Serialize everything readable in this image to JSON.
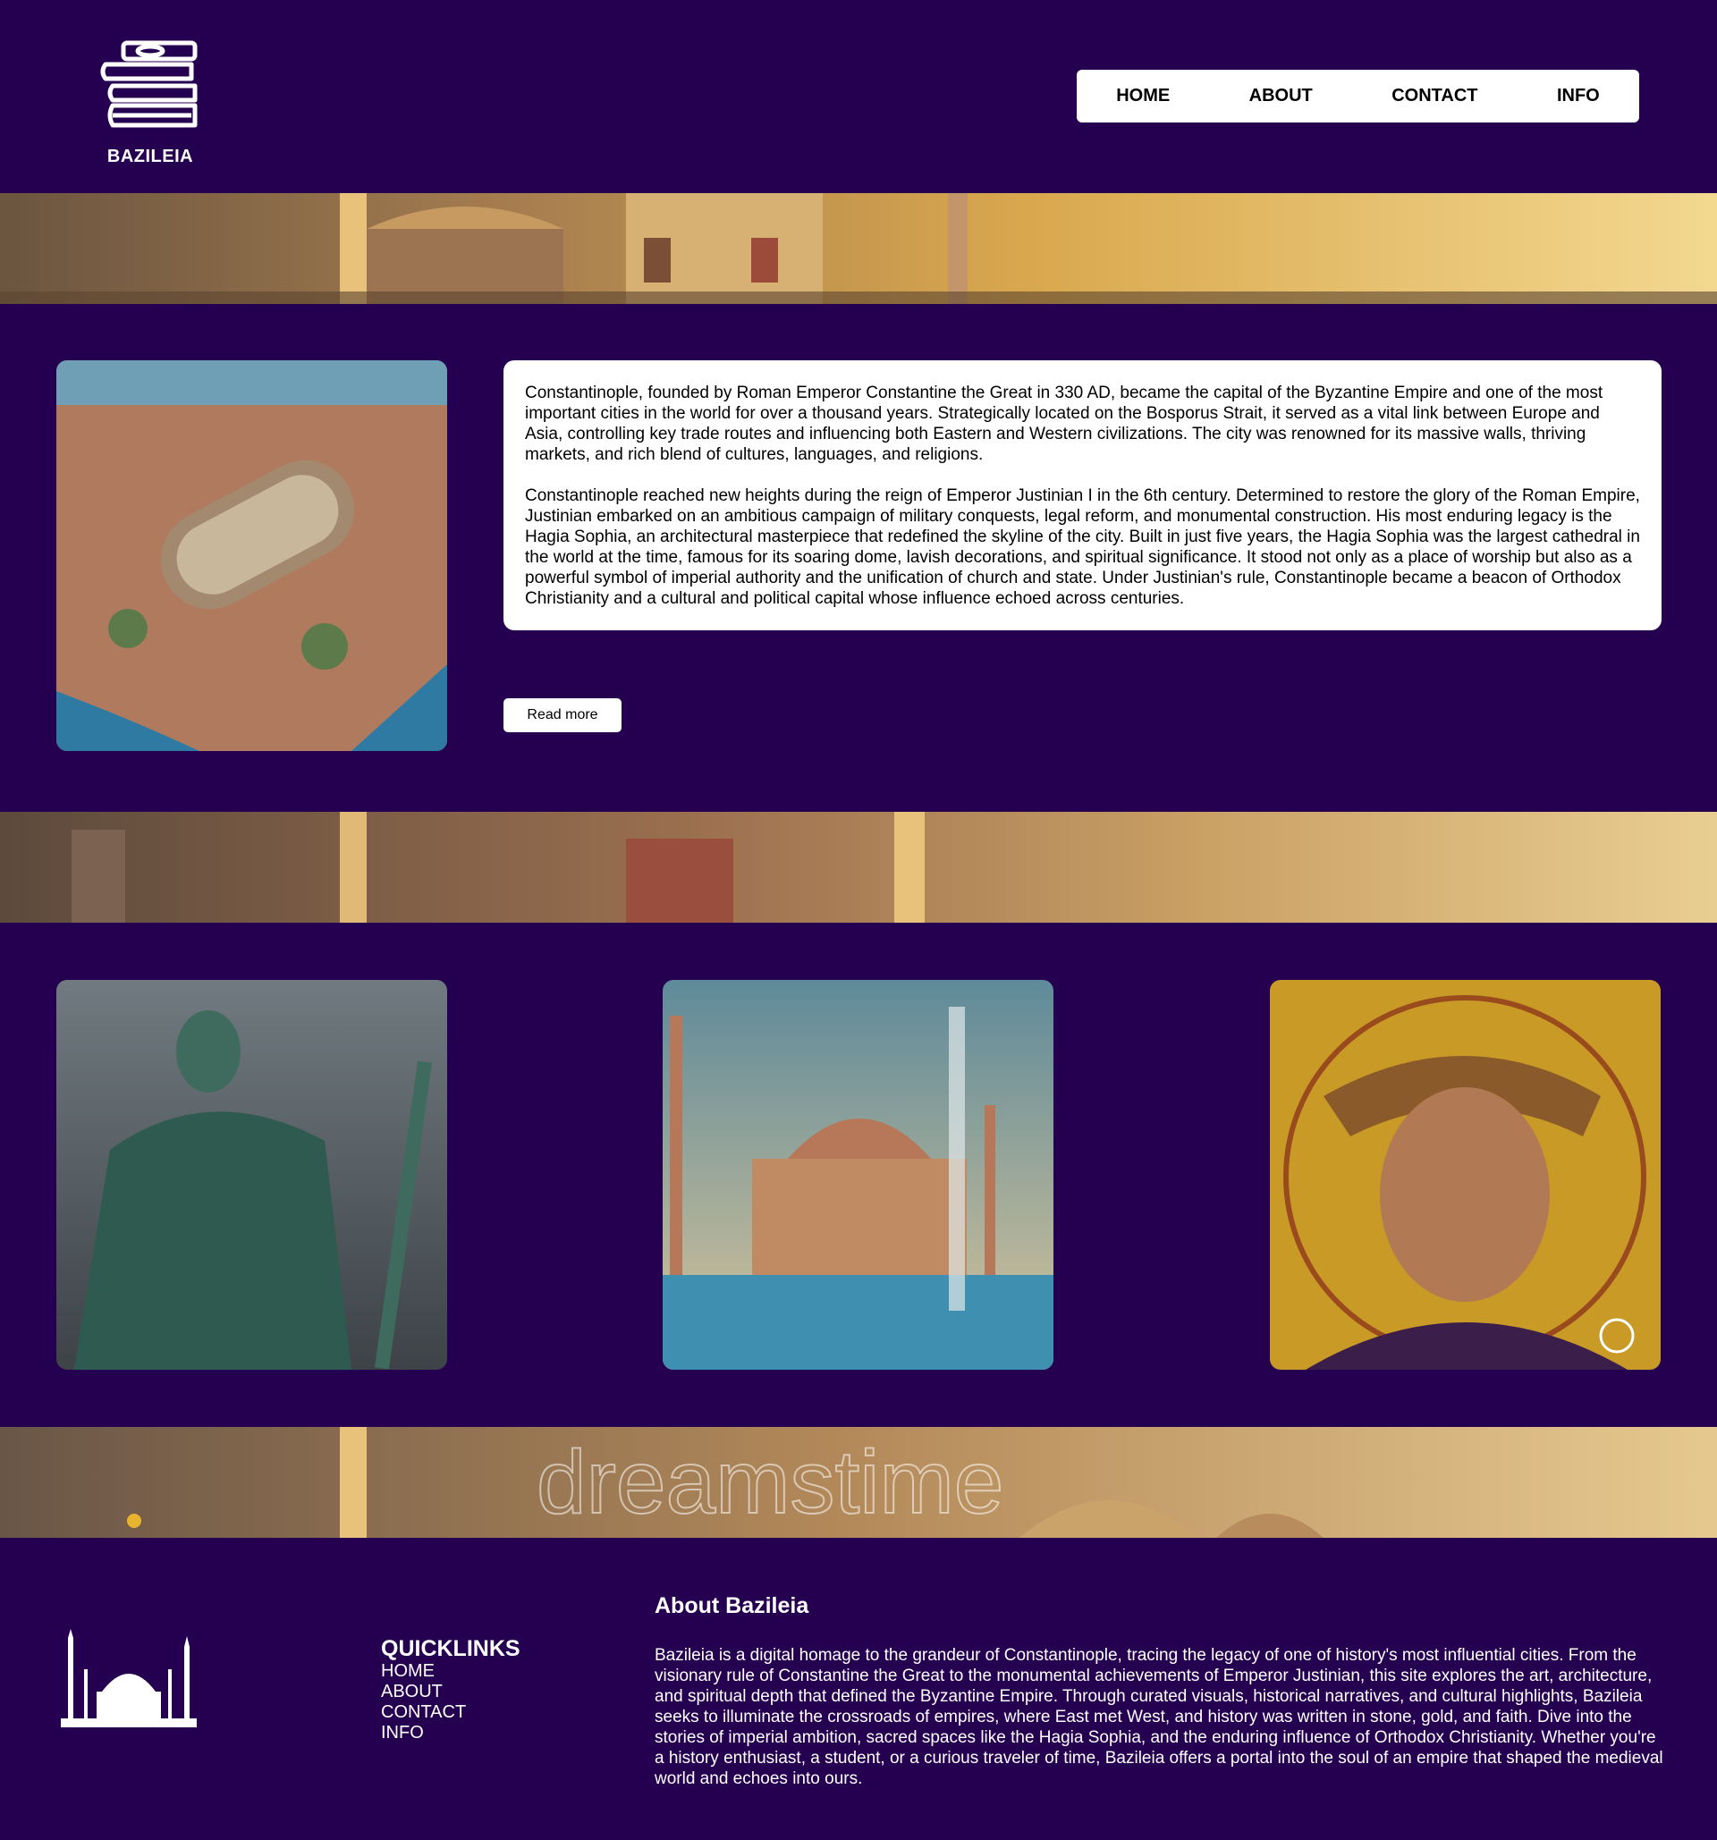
{
  "header": {
    "brand": "BAZILEIA",
    "nav": [
      "HOME",
      "ABOUT",
      "CONTACT",
      "INFO"
    ]
  },
  "intro": {
    "paragraphs": [
      "Constantinople, founded by Roman Emperor Constantine the Great in 330 AD, became the capital of the Byzantine Empire and one of the most important cities in the world for over a thousand years. Strategically located on the Bosporus Strait, it served as a vital link between Europe and Asia, controlling key trade routes and influencing both Eastern and Western civilizations. The city was renowned for its massive walls, thriving markets, and rich blend of cultures, languages, and religions.",
      "Constantinople reached new heights during the reign of Emperor Justinian I in the 6th century. Determined to restore the glory of the Roman Empire, Justinian embarked on an ambitious campaign of military conquests, legal reform, and monumental construction. His most enduring legacy is the Hagia Sophia, an architectural masterpiece that redefined the skyline of the city. Built in just five years, the Hagia Sophia was the largest cathedral in the world at the time, famous for its soaring dome, lavish decorations, and spiritual significance. It stood not only as a place of worship but also as a powerful symbol of imperial authority and the unification of church and state. Under Justinian's rule, Constantinople became a beacon of Orthodox Christianity and a cultural and political capital whose influence echoed across centuries."
    ],
    "read_more": "Read more"
  },
  "banner_watermark": "dreamstime",
  "footer": {
    "quicklinks_title": "QUICKLINKS",
    "links": [
      "HOME",
      "ABOUT",
      "CONTACT",
      "INFO"
    ],
    "about_title": "About Bazileia",
    "about_text": "Bazileia is a digital homage to the grandeur of Constantinople, tracing the legacy of one of history's most influential cities. From the visionary rule of Constantine the Great to the monumental achievements of Emperor Justinian, this site explores the art, architecture, and spiritual depth that defined the Byzantine Empire. Through curated visuals, historical narratives, and cultural highlights, Bazileia seeks to illuminate the crossroads of empires, where East met West, and history was written in stone, gold, and faith. Dive into the stories of imperial ambition, sacred spaces like the Hagia Sophia, and the enduring influence of Orthodox Christianity. Whether you're a history enthusiast, a student, or a curious traveler of time, Bazileia offers a portal into the soul of an empire that shaped the medieval world and echoes into ours."
  },
  "colors": {
    "background": "#250050",
    "panel": "#ffffff",
    "gold": "#d9a84e"
  }
}
